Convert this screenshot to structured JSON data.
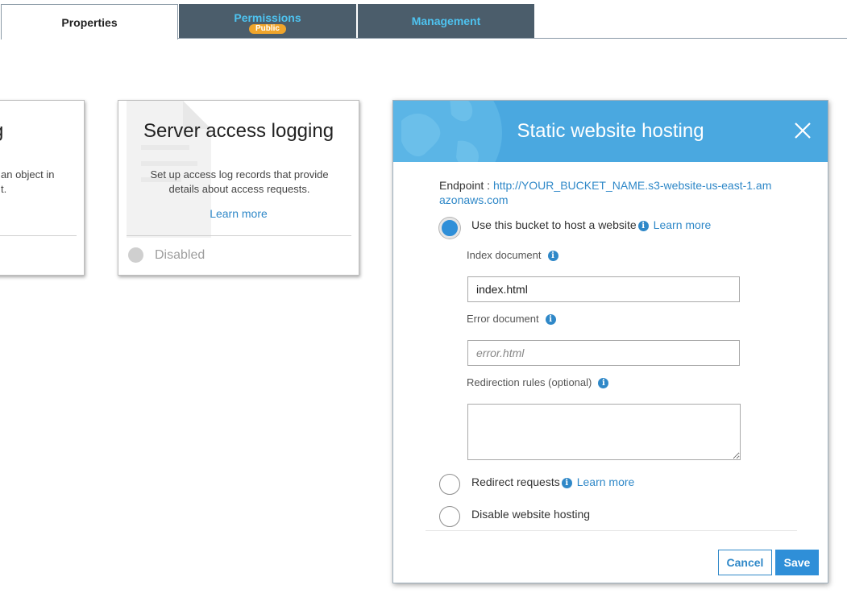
{
  "tabs": [
    {
      "label": "Properties"
    },
    {
      "label": "Permissions",
      "badge": "Public"
    },
    {
      "label": "Management"
    }
  ],
  "cards": {
    "left_fragment": {
      "title_fragment": "g",
      "desc_line1": "an object in",
      "desc_line2": "t."
    },
    "server_access_logging": {
      "title": "Server access logging",
      "description": "Set up access log records that provide details about access requests.",
      "learn_more": "Learn more",
      "status": "Disabled"
    }
  },
  "modal": {
    "title": "Static website hosting",
    "endpoint_label": "Endpoint : ",
    "endpoint_url": "http://YOUR_BUCKET_NAME.s3-website-us-east-1.amazonaws.com",
    "options": {
      "host": {
        "label": "Use this bucket to host a website",
        "learn_more": "Learn more",
        "selected": true
      },
      "redirect": {
        "label": "Redirect requests",
        "learn_more": "Learn more",
        "selected": false
      },
      "disable": {
        "label": "Disable website hosting",
        "selected": false
      }
    },
    "index_document": {
      "label": "Index document",
      "value": "index.html"
    },
    "error_document": {
      "label": "Error document",
      "placeholder": "error.html"
    },
    "redirection_rules": {
      "label": "Redirection rules (optional)",
      "value": ""
    },
    "buttons": {
      "cancel": "Cancel",
      "save": "Save"
    }
  },
  "colors": {
    "tab_dark": "#4b5d6b",
    "tab_text": "#4ec3f0",
    "badge": "#f0a52b",
    "modal_header": "#4aa8e0",
    "link": "#2f88c8",
    "primary": "#2f8fd8"
  },
  "icons": [
    "close-icon",
    "info-icon",
    "globe-icon",
    "document-icon"
  ]
}
